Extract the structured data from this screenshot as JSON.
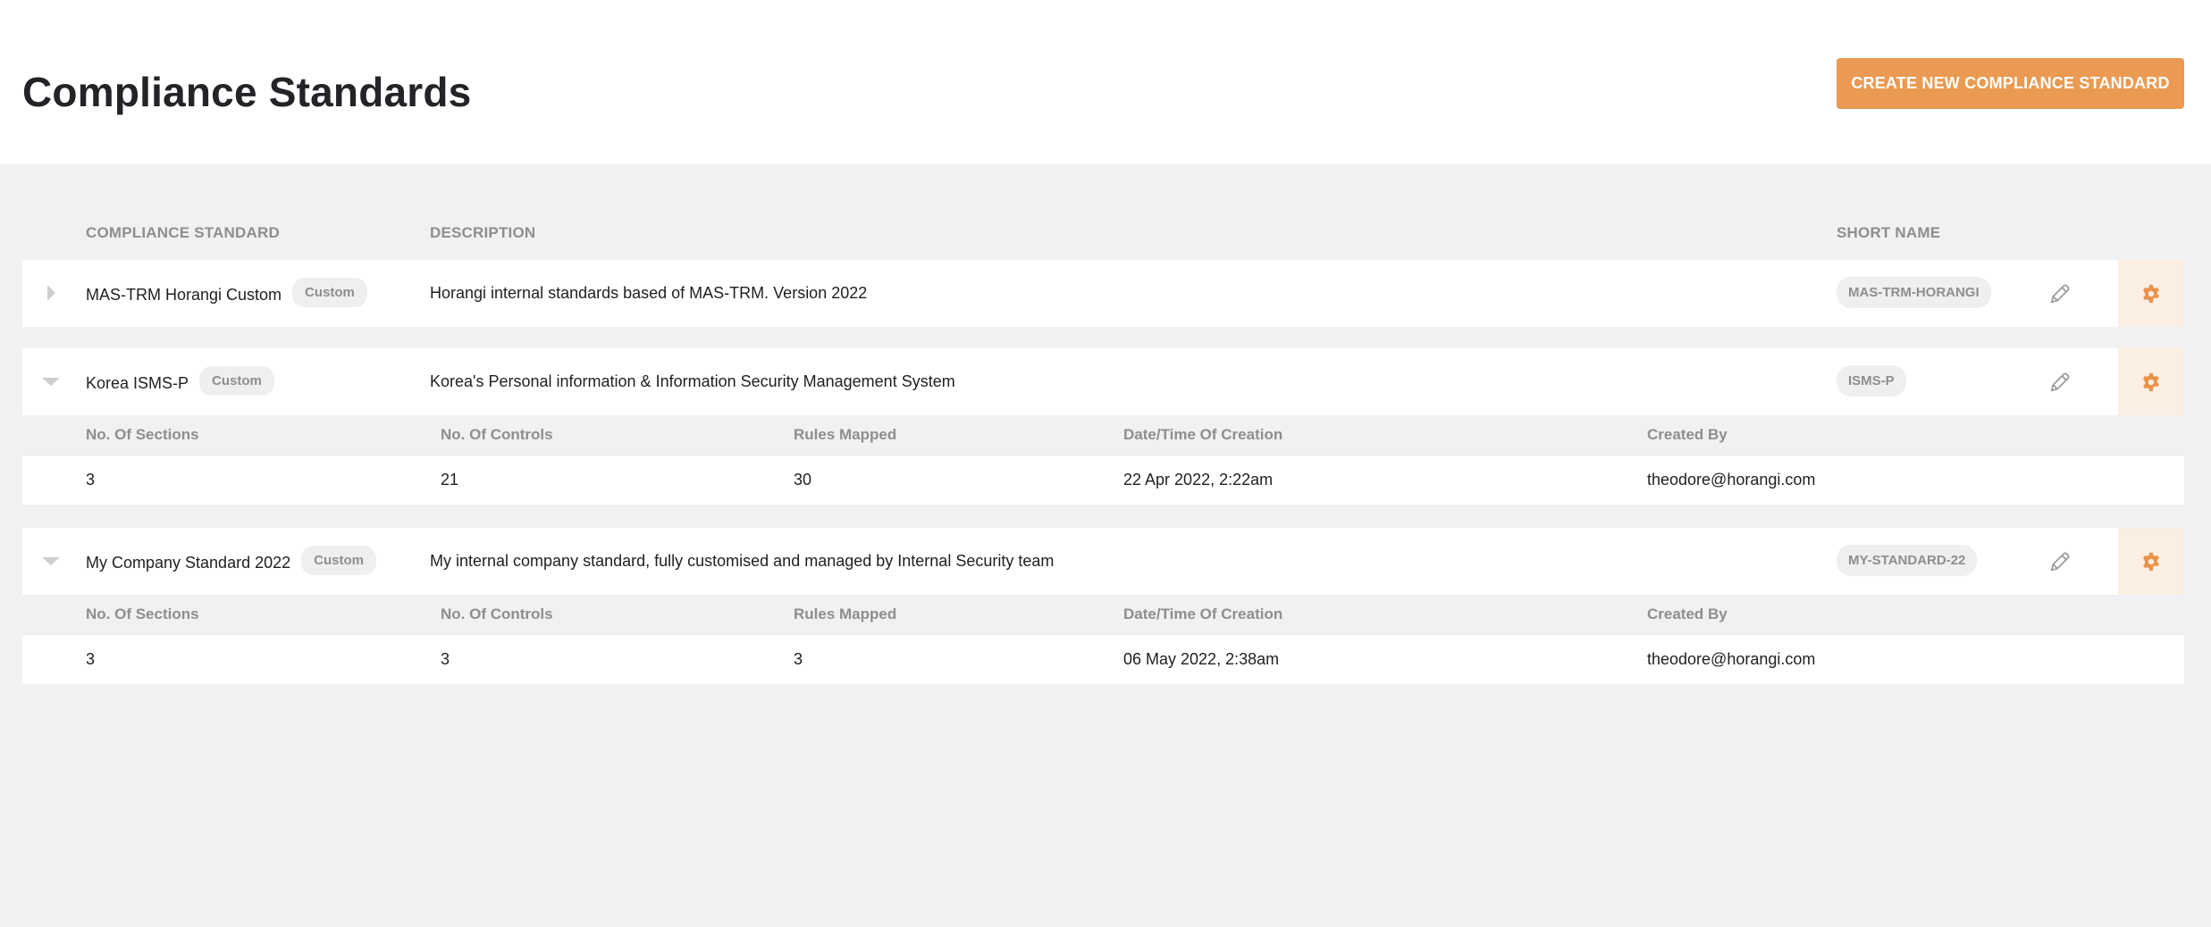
{
  "header": {
    "title": "Compliance Standards",
    "create_button_label": "CREATE NEW COMPLIANCE STANDARD"
  },
  "colors": {
    "accent": "#ea9a52",
    "settings_bg": "#fbeee2",
    "badge_bg": "#efefef",
    "muted_text": "#8e8e8e",
    "page_bg": "#f2f2f2"
  },
  "table": {
    "columns": [
      "COMPLIANCE STANDARD",
      "DESCRIPTION",
      "SHORT NAME"
    ],
    "detail_columns": [
      "No. Of Sections",
      "No. Of Controls",
      "Rules Mapped",
      "Date/Time Of Creation",
      "Created By"
    ],
    "rows": [
      {
        "name": "MAS-TRM Horangi Custom",
        "badge": "Custom",
        "description": "Horangi internal standards based of MAS-TRM. Version 2022",
        "short_name": "MAS-TRM-HORANGI",
        "expanded": false,
        "toggle_icon": "caret-right-icon",
        "edit_icon": "pencil-icon",
        "settings_icon": "gear-icon"
      },
      {
        "name": "Korea ISMS-P",
        "badge": "Custom",
        "description": "Korea's Personal information & Information Security Management System",
        "short_name": "ISMS-P",
        "expanded": true,
        "toggle_icon": "caret-down-icon",
        "edit_icon": "pencil-icon",
        "settings_icon": "gear-icon",
        "details": {
          "sections": "3",
          "controls": "21",
          "rules_mapped": "30",
          "created_at": "22 Apr 2022, 2:22am",
          "created_by": "theodore@horangi.com"
        }
      },
      {
        "name": "My Company Standard 2022",
        "badge": "Custom",
        "description": "My internal company standard, fully customised and managed by Internal Security team",
        "short_name": "MY-STANDARD-22",
        "expanded": true,
        "toggle_icon": "caret-down-icon",
        "edit_icon": "pencil-icon",
        "settings_icon": "gear-icon",
        "details": {
          "sections": "3",
          "controls": "3",
          "rules_mapped": "3",
          "created_at": "06 May 2022, 2:38am",
          "created_by": "theodore@horangi.com"
        }
      }
    ]
  }
}
